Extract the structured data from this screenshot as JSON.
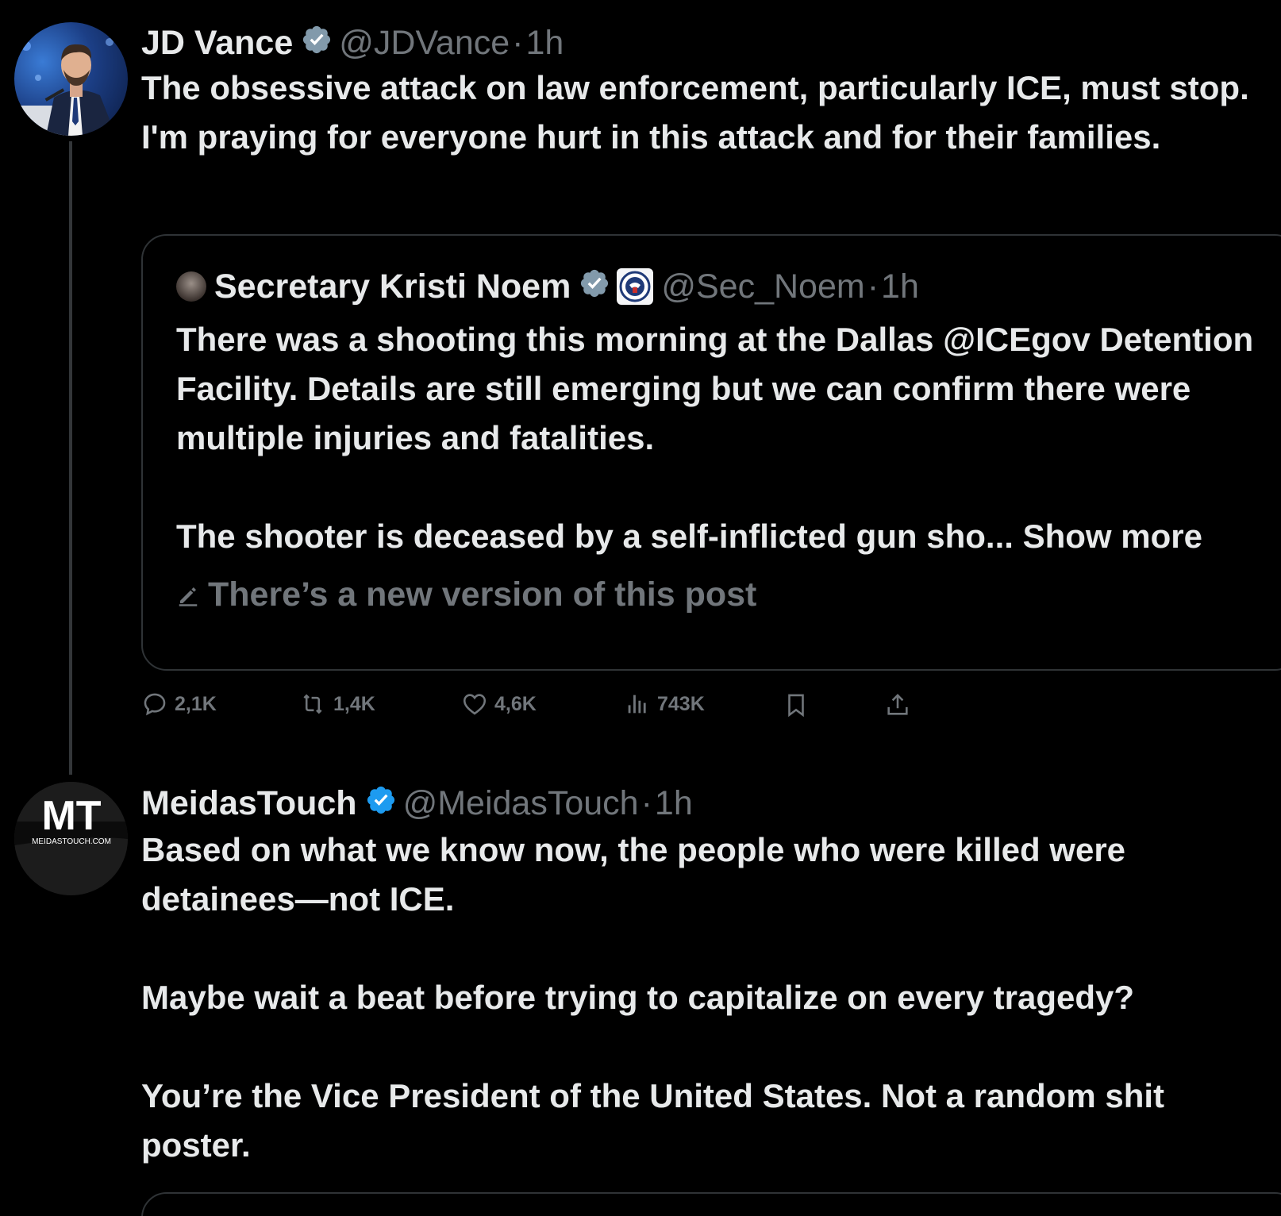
{
  "colors": {
    "background": "#000000",
    "text_primary": "#e7e9ea",
    "text_secondary": "#71767b",
    "verified_blue": "#1d9bf0",
    "verified_gray": "#829aab",
    "border": "#2f3336"
  },
  "post1": {
    "name": "JD Vance",
    "verified_badge": "gray",
    "handle": "@JDVance",
    "separator": "·",
    "time": "1h",
    "text": "The obsessive attack on law enforcement, particularly ICE, must stop. I'm praying for everyone hurt in this attack and for their families.",
    "quote": {
      "name": "Secretary Kristi Noem",
      "verified_badge": "gray",
      "affiliation_icon": "dhs-seal-icon",
      "handle": "@Sec_Noem",
      "separator": "·",
      "time": "1h",
      "text": "There was a shooting this morning at the Dallas @ICEgov Detention Facility. Details are still emerging but we can confirm there were multiple injuries and fatalities.\n\nThe shooter is deceased by a self-inflicted gun sho...",
      "show_more": "Show more",
      "edited_note": "There’s a new version of this post"
    },
    "actions": {
      "replies": "2,1K",
      "reposts": "1,4K",
      "likes": "4,6K",
      "views": "743K"
    }
  },
  "post2": {
    "name": "MeidasTouch",
    "verified_badge": "blue",
    "handle": "@MeidasTouch",
    "separator": "·",
    "time": "1h",
    "avatar_logo": "MT",
    "avatar_sub": "MEIDASTOUCH.COM",
    "text": "Based on what we know now, the people who were killed were detainees—not ICE.\n\nMaybe wait a beat before trying to capitalize on every tragedy?\n\nYou’re the Vice President of the United States. Not a random shit poster."
  }
}
